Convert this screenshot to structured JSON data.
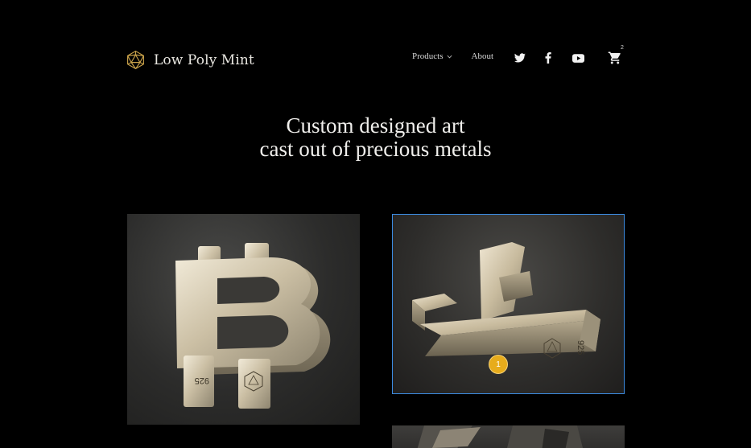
{
  "header": {
    "brand": "Low Poly Mint",
    "nav": {
      "products_label": "Products",
      "about_label": "About"
    },
    "social": [
      {
        "icon": "twitter-icon"
      },
      {
        "icon": "facebook-icon"
      },
      {
        "icon": "youtube-icon"
      }
    ],
    "cart": {
      "icon": "cart-icon",
      "count": "2"
    }
  },
  "hero": {
    "line1": "Custom designed art",
    "line2": "cast out of precious metals"
  },
  "products": [
    {
      "name": "bitcoin-product",
      "stamp": "925"
    },
    {
      "name": "litecoin-product",
      "stamp": "925"
    },
    {
      "name": "third-product"
    }
  ],
  "badge": {
    "label": "1"
  },
  "colors": {
    "background": "#000000",
    "accent_gold": "#c9a24a",
    "selection_outline": "#3c8be0",
    "badge": "#e7ac1c"
  }
}
